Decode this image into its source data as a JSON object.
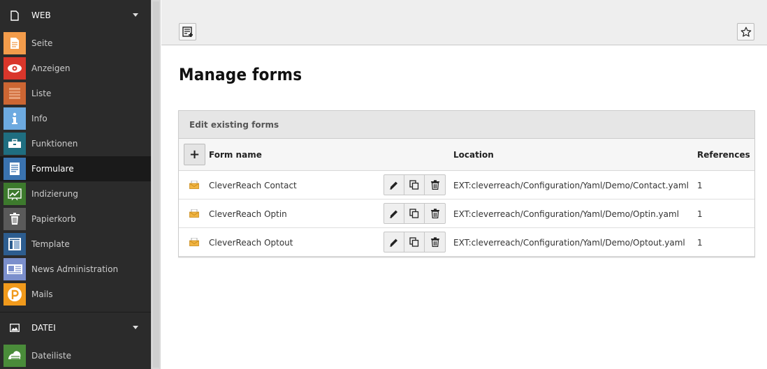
{
  "sidebar": {
    "groups": [
      {
        "label": "WEB",
        "icon": "page-icon",
        "items": [
          {
            "label": "Seite",
            "icon": "page-module-icon",
            "color": "#f39c4b",
            "active": false
          },
          {
            "label": "Anzeigen",
            "icon": "eye-icon",
            "color": "#d9362b",
            "active": false
          },
          {
            "label": "Liste",
            "icon": "list-icon",
            "color": "#cc6633",
            "active": false
          },
          {
            "label": "Info",
            "icon": "info-icon",
            "color": "#6daae0",
            "active": false
          },
          {
            "label": "Funktionen",
            "icon": "toolbox-icon",
            "color": "#1f6e80",
            "active": false
          },
          {
            "label": "Formulare",
            "icon": "form-icon",
            "color": "#3a73b0",
            "active": true
          },
          {
            "label": "Indizierung",
            "icon": "chart-icon",
            "color": "#3d7a2d",
            "active": false
          },
          {
            "label": "Papierkorb",
            "icon": "trash-icon",
            "color": "#5a5a5a",
            "active": false
          },
          {
            "label": "Template",
            "icon": "template-icon",
            "color": "#2d5d8f",
            "active": false
          },
          {
            "label": "News Administration",
            "icon": "newspaper-icon",
            "color": "#7b8fcc",
            "active": false
          },
          {
            "label": "Mails",
            "icon": "mail-p-icon",
            "color": "#f19a1c",
            "active": false
          }
        ]
      },
      {
        "label": "DATEI",
        "icon": "image-icon",
        "items": [
          {
            "label": "Dateiliste",
            "icon": "filelist-icon",
            "color": "#4a8c3a",
            "active": false
          }
        ]
      }
    ]
  },
  "page": {
    "title": "Manage forms"
  },
  "panel": {
    "heading": "Edit existing forms",
    "columns": {
      "name": "Form name",
      "location": "Location",
      "references": "References"
    },
    "rows": [
      {
        "name": "CleverReach Contact",
        "location": "EXT:cleverreach/Configuration/Yaml/Demo/Contact.yaml",
        "references": "1"
      },
      {
        "name": "CleverReach Optin",
        "location": "EXT:cleverreach/Configuration/Yaml/Demo/Optin.yaml",
        "references": "1"
      },
      {
        "name": "CleverReach Optout",
        "location": "EXT:cleverreach/Configuration/Yaml/Demo/Optout.yaml",
        "references": "1"
      }
    ]
  }
}
